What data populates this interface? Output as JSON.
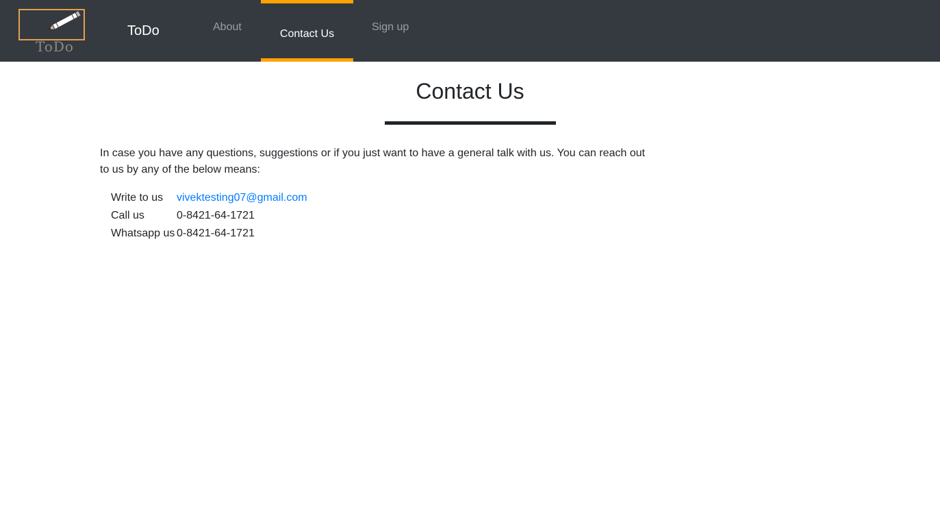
{
  "logo": {
    "text": "ToDo",
    "accent_color": "#e6a04b",
    "icon": "pencil-icon"
  },
  "navbar": {
    "brand": "ToDo",
    "links": [
      {
        "label": "About",
        "active": false
      },
      {
        "label": "Contact Us",
        "active": true
      },
      {
        "label": "Sign up",
        "active": false
      }
    ],
    "background": "#343a40",
    "active_accent": "#ffa200"
  },
  "main": {
    "title": "Contact Us",
    "intro": "In case you have any questions, suggestions or if you just want to have a general talk with us. You can reach out to us by any of the below means:",
    "contacts": [
      {
        "label": "Write to us",
        "value": "vivektesting07@gmail.com",
        "link": true
      },
      {
        "label": "Call us",
        "value": "0-8421-64-1721",
        "link": false
      },
      {
        "label": "Whatsapp us",
        "value": "0-8421-64-1721",
        "link": false
      }
    ],
    "link_color": "#007bff"
  }
}
